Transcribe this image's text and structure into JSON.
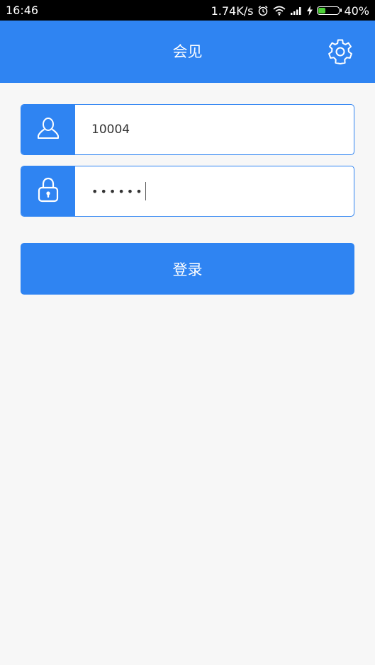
{
  "status_bar": {
    "time": "16:46",
    "network_speed": "1.74K/s",
    "battery_percent": "40%",
    "battery_level": 0.4,
    "icons": [
      "alarm-icon",
      "wifi-icon",
      "signal-icon",
      "charging-icon",
      "battery-icon"
    ]
  },
  "header": {
    "title": "会见",
    "settings_icon": "gear-icon"
  },
  "login_form": {
    "username": {
      "icon": "user-icon",
      "value": "10004"
    },
    "password": {
      "icon": "lock-icon",
      "value": "••••••"
    },
    "submit_label": "登录"
  },
  "colors": {
    "primary": "#2f84f2",
    "background": "#f7f7f7",
    "status_bar": "#000000",
    "battery_fill": "#4cd137"
  }
}
